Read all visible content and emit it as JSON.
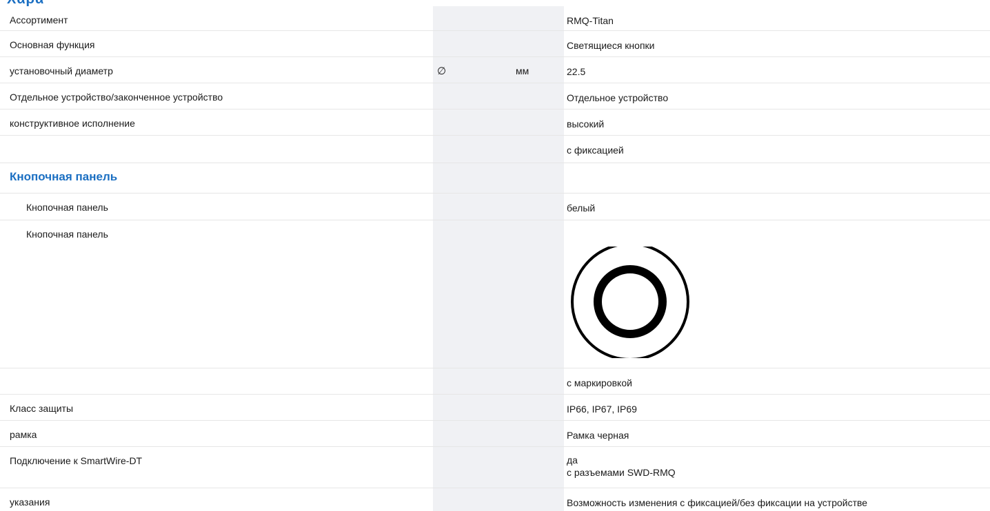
{
  "header": {
    "partial_title": "Χαρα"
  },
  "rows": {
    "assortment": {
      "label": "Ассортимент",
      "value": "RMQ-Titan"
    },
    "main_function": {
      "label": "Основная функция",
      "value": "Светящиеся кнопки"
    },
    "mount_diameter": {
      "label": "установочный диаметр",
      "symbol": "∅",
      "unit": "мм",
      "value": "22.5"
    },
    "device_type": {
      "label": "Отдельное устройство/законченное устройство",
      "value": "Отдельное устройство"
    },
    "design": {
      "label": "конструктивное исполнение",
      "value": "высокий"
    },
    "latching": {
      "label": "",
      "value": "с фиксацией"
    },
    "section_button_plate": {
      "title": "Кнопочная панель"
    },
    "button_plate_color": {
      "label": "Кнопочная панель",
      "value": "белый"
    },
    "button_plate_symbol": {
      "label": "Кнопочная панель",
      "symbol_icon": "circle-in-circle-icon"
    },
    "marking": {
      "label": "",
      "value": "с маркировкой"
    },
    "protection_class": {
      "label": "Класс защиты",
      "value": "IP66, IP67, IP69"
    },
    "frame": {
      "label": "рамка",
      "value": "Рамка черная"
    },
    "smartwire": {
      "label": "Подключение к SmartWire-DT",
      "value": "да",
      "value_line2": "с разъемами SWD-RMQ"
    },
    "notes": {
      "label": "указания",
      "value": "Возможность изменения с фиксацией/без фиксации на устройстве"
    }
  },
  "colors": {
    "accent": "#1b6fc2",
    "column_shade": "#f0f1f4",
    "divider": "#e6e6e6"
  }
}
